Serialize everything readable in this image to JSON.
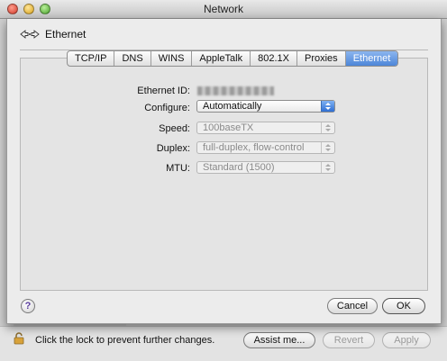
{
  "window": {
    "title": "Network"
  },
  "sheet": {
    "interface_name": "Ethernet",
    "tabs": [
      {
        "label": "TCP/IP",
        "active": false
      },
      {
        "label": "DNS",
        "active": false
      },
      {
        "label": "WINS",
        "active": false
      },
      {
        "label": "AppleTalk",
        "active": false
      },
      {
        "label": "802.1X",
        "active": false
      },
      {
        "label": "Proxies",
        "active": false
      },
      {
        "label": "Ethernet",
        "active": true
      }
    ],
    "form": {
      "ethernet_id_label": "Ethernet ID:",
      "configure_label": "Configure:",
      "configure_value": "Automatically",
      "speed_label": "Speed:",
      "speed_value": "100baseTX",
      "duplex_label": "Duplex:",
      "duplex_value": "full-duplex, flow-control",
      "mtu_label": "MTU:",
      "mtu_value": "Standard  (1500)"
    },
    "help_label": "?",
    "cancel_label": "Cancel",
    "ok_label": "OK"
  },
  "bottom": {
    "lock_text": "Click the lock to prevent further changes.",
    "assist_label": "Assist me...",
    "revert_label": "Revert",
    "apply_label": "Apply"
  },
  "colors": {
    "accent": "#4d86d8",
    "sheet_bg": "#ececec"
  },
  "icons": {
    "interface": "ethernet-arrows-icon",
    "lock": "padlock-icon"
  }
}
